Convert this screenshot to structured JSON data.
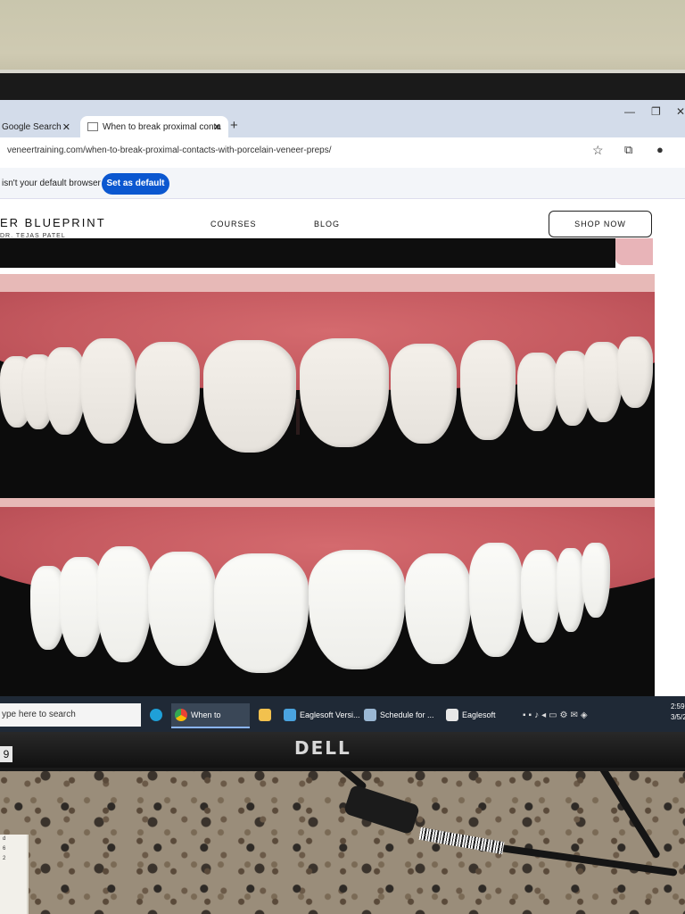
{
  "browser": {
    "tabs": [
      {
        "label": "Google Search"
      },
      {
        "label": "When to break proximal conta"
      }
    ],
    "url": "veneertraining.com/when-to-break-proximal-contacts-with-porcelain-veneer-preps/",
    "infobar_text": "isn't your default browser",
    "set_default_label": "Set as default",
    "new_tab_symbol": "+",
    "close_symbol": "✕",
    "icons": [
      "star-icon",
      "extensions-icon",
      "profile-icon"
    ]
  },
  "site": {
    "brand": "ER BLUEPRINT",
    "subbrand": "DR. TEJAS PATEL",
    "nav": [
      "COURSES",
      "BLOG"
    ],
    "shop_label": "SHOP NOW"
  },
  "taskbar": {
    "search_placeholder": "ype here to search",
    "items": [
      {
        "label": "When to break...",
        "icon": "chrome-icon"
      },
      {
        "label": "Eaglesoft Versi...",
        "icon": "eaglesoft-icon"
      },
      {
        "label": "Schedule for ...",
        "icon": "schedule-icon"
      },
      {
        "label": "Eaglesoft Adva...",
        "icon": "eaglesoft-icon"
      }
    ],
    "time": "2:59",
    "date": "3/5/2"
  },
  "monitor": {
    "brand": "DELL",
    "bezel_number": "9"
  },
  "paper_note": [
    "d",
    "6",
    "2"
  ]
}
